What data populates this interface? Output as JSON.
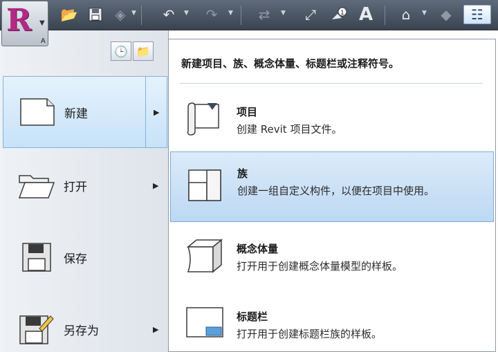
{
  "quick_access": {
    "app_key_tip": "A",
    "icons": [
      "open-icon",
      "save-icon",
      "sync-icon",
      "undo-icon",
      "redo-icon",
      "align-icon",
      "measure-icon",
      "tag-icon",
      "text-icon",
      "3d-view-icon",
      "section-icon",
      "switch-windows-icon"
    ]
  },
  "app_menu": {
    "items": [
      {
        "label": "新建"
      },
      {
        "label": "打开"
      },
      {
        "label": "保存"
      },
      {
        "label": "另存为"
      }
    ]
  },
  "submenu": {
    "header": "新建项目、族、概念体量、标题栏或注释符号。",
    "items": [
      {
        "title": "项目",
        "desc": "创建 Revit 项目文件。"
      },
      {
        "title": "族",
        "desc": "创建一组自定义构件，以便在项目中使用。"
      },
      {
        "title": "概念体量",
        "desc": "打开用于创建概念体量模型的样板。"
      },
      {
        "title": "标题栏",
        "desc": "打开用于创建标题栏族的样板。"
      }
    ]
  },
  "colors": {
    "selection_fill": "#c7e2f8",
    "selection_border": "#7fb2de",
    "toolbar": "#4a5461",
    "logo": "#b02a86"
  }
}
